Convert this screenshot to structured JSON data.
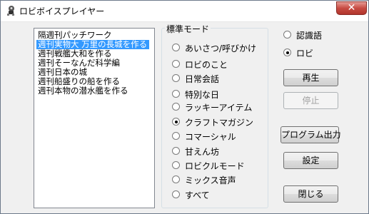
{
  "window": {
    "title": "ロビボイスプレイヤー",
    "close_glyph": "✕"
  },
  "episode_list": {
    "items": [
      "隔週刊パッチワーク",
      "週刊実物大 万里の長城を作る",
      "週刊戦艦大和を作る",
      "週刊そーなんだ科学編",
      "週刊日本の城",
      "週刊船盛りの船を作る",
      "週刊本物の潜水艦を作る"
    ],
    "selected_index": 1
  },
  "mode_group": {
    "title": "標準モード",
    "options": [
      "あいさつ/呼びかけ",
      "ロビのこと",
      "日常会話",
      "特別な日",
      "ラッキーアイテム",
      "クラフトマガジン",
      "コマーシャル",
      "甘えん坊",
      "ロビクルモード",
      "ミックス音声",
      "すべて"
    ],
    "selected_index": 5
  },
  "voice_mode": {
    "options": [
      "認識語",
      "ロビ"
    ],
    "selected_index": 1
  },
  "buttons": {
    "play": "再生",
    "stop": "停止",
    "program_output": "プログラム出力",
    "settings": "設定",
    "close": "閉じる"
  }
}
